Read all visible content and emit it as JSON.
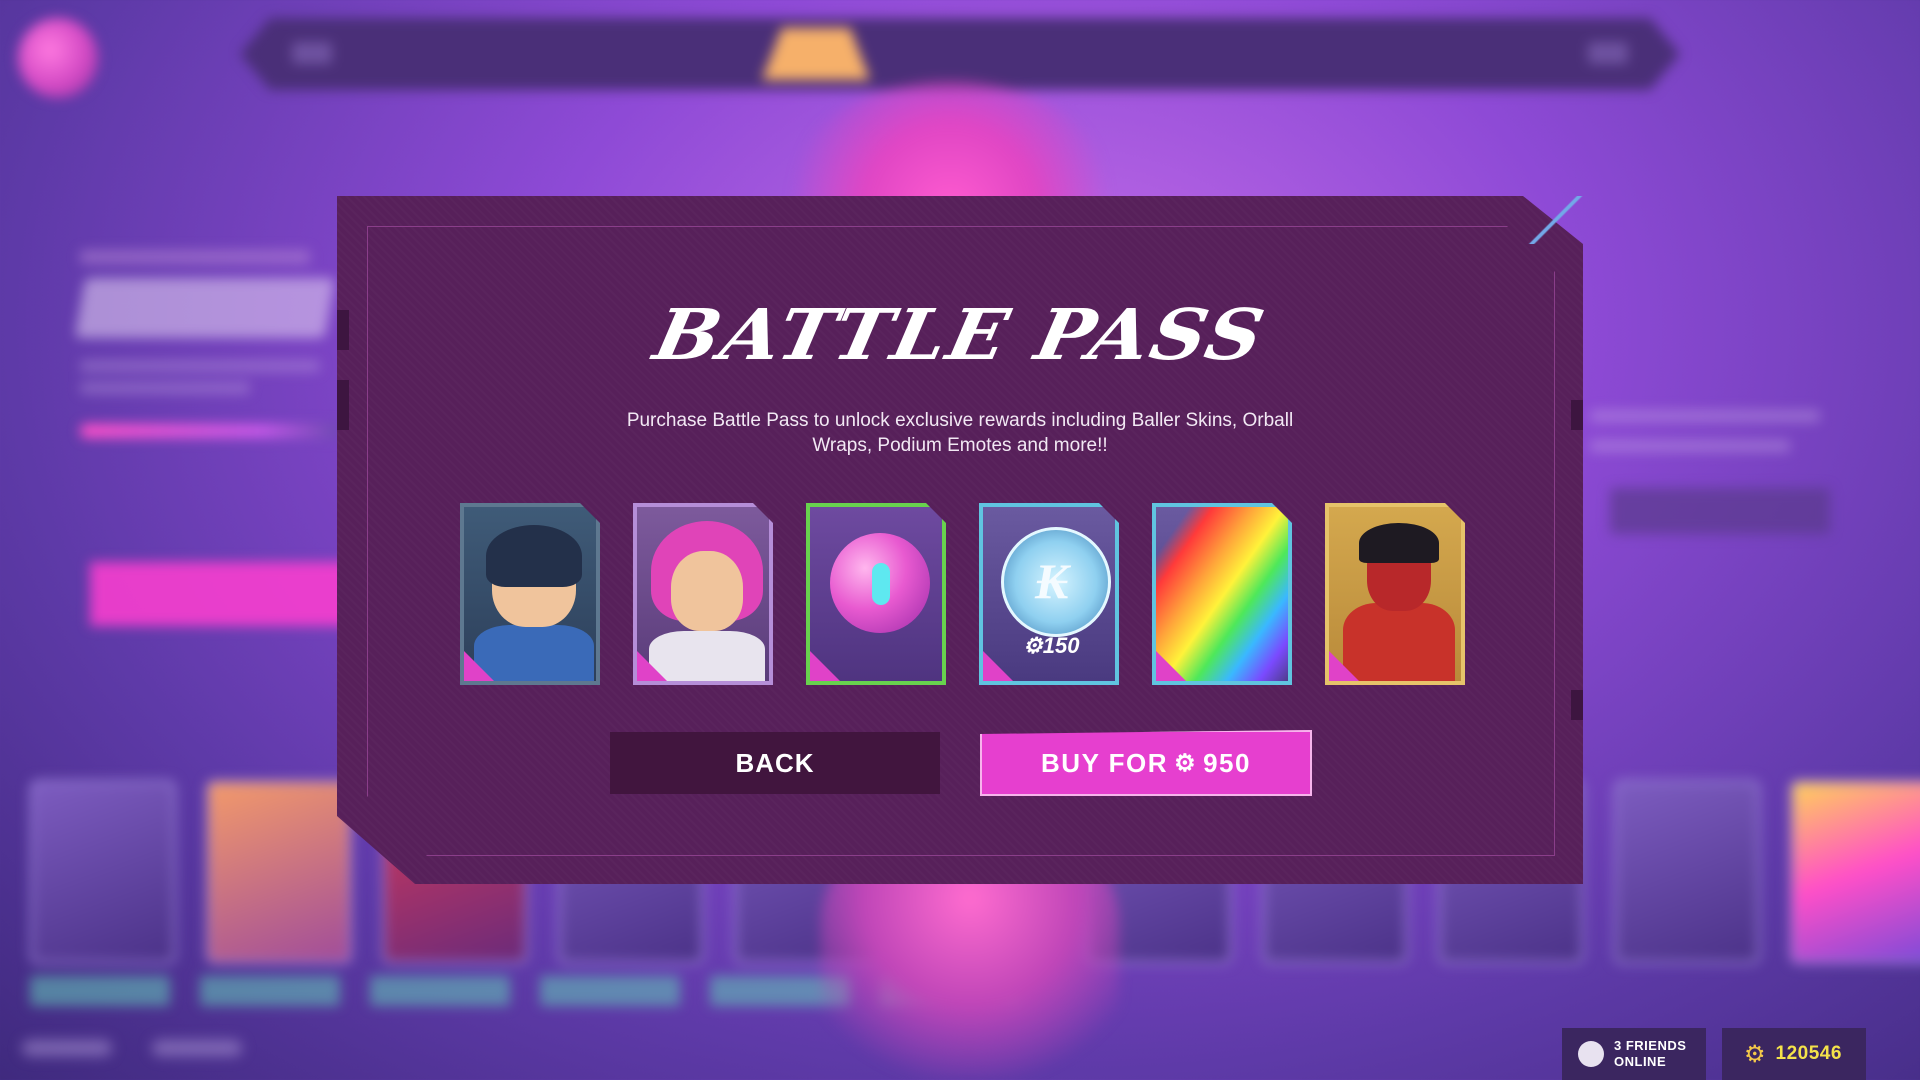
{
  "modal": {
    "title": "BATTLE PASS",
    "description": "Purchase Battle Pass to unlock exclusive rewards including Baller Skins, Orball Wraps, Podium Emotes and more!!",
    "rewards": [
      {
        "kind": "baller-skin",
        "label": ""
      },
      {
        "kind": "baller-skin",
        "label": ""
      },
      {
        "kind": "orball-wrap",
        "label": ""
      },
      {
        "kind": "currency",
        "label": "150"
      },
      {
        "kind": "trail",
        "label": ""
      },
      {
        "kind": "baller-skin",
        "label": ""
      }
    ],
    "back_label": "BACK",
    "buy_label": "BUY FOR",
    "buy_price": "950"
  },
  "footer": {
    "friends_label": "3 FRIENDS",
    "friends_sub": "ONLINE",
    "currency_amount": "120546"
  },
  "colors": {
    "accent": "#e63fcf",
    "modal_bg": "#57205a",
    "currency": "#f4e24a",
    "edge_highlight": "#73a8e8"
  }
}
